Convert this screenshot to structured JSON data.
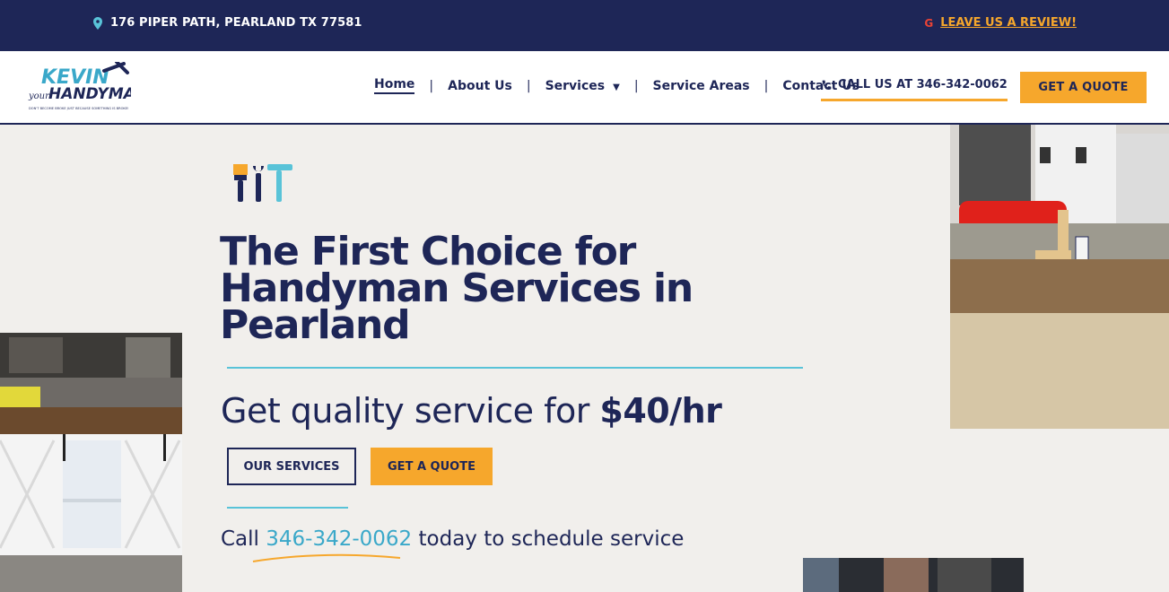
{
  "topbar": {
    "address": "176 PIPER PATH, PEARLAND TX 77581",
    "review_link": "LEAVE US A REVIEW!",
    "icons": {
      "address": "map-pin-icon",
      "review": "google-icon"
    }
  },
  "header": {
    "logo_text_top": "KEVIN",
    "logo_text_your": "your",
    "logo_text_main": "HANDYMAN",
    "logo_tagline": "DON'T BECOME BROKE JUST BECAUSE SOMETHING IS BROKE!",
    "nav": [
      {
        "label": "Home",
        "active": true
      },
      {
        "label": "About Us"
      },
      {
        "label": "Services",
        "has_dropdown": true
      },
      {
        "label": "Service Areas"
      },
      {
        "label": "Contact Us"
      }
    ],
    "call_label": "CALL US AT 346-342-0062",
    "quote_label": "GET A QUOTE"
  },
  "hero": {
    "headline": "The First Choice for Handyman Services in Pearland",
    "subhead_prefix": "Get quality service for ",
    "subhead_price": "$40/hr",
    "btn_services": "OUR SERVICES",
    "btn_quote": "GET A QUOTE",
    "call_prefix": "Call ",
    "call_phone": "346-342-0062",
    "call_suffix": " today to schedule service"
  },
  "colors": {
    "navy": "#1e2657",
    "orange": "#f6a72c",
    "teal": "#59c3d8",
    "background": "#f1efec"
  }
}
